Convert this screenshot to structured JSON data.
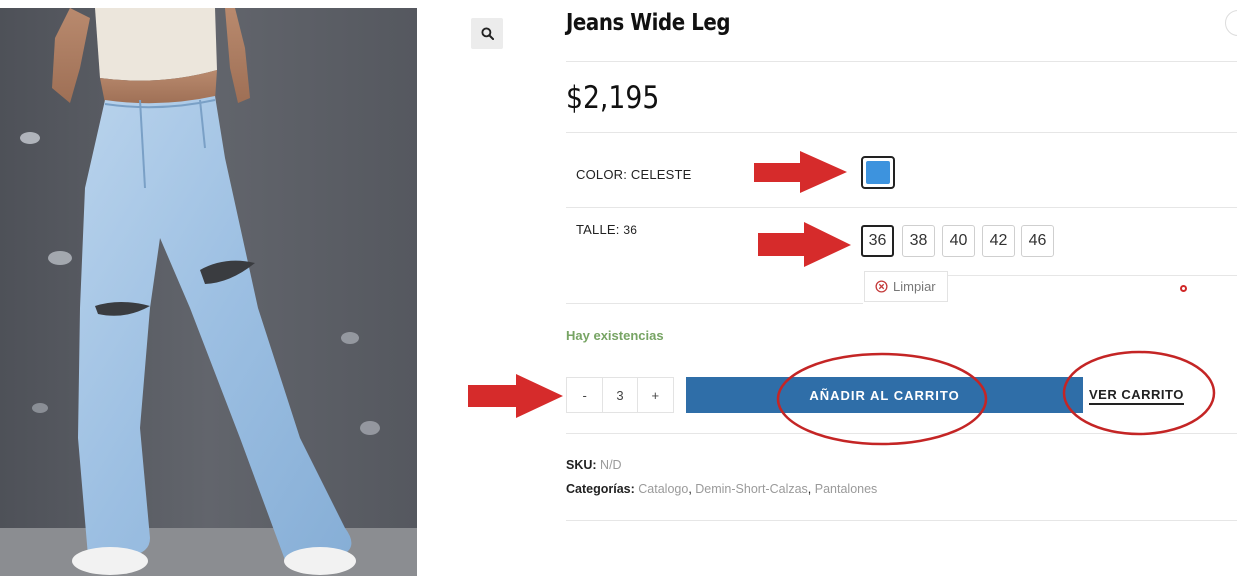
{
  "product": {
    "title": "Jeans Wide Leg",
    "price": "$2,195",
    "image_alt": "product-photo-jeans",
    "stock": "Hay existencias"
  },
  "attributes": {
    "color": {
      "label": "COLOR",
      "value": "CELESTE",
      "swatch_color": "#3d93de"
    },
    "size": {
      "label": "TALLE",
      "value": "36",
      "options": [
        "36",
        "38",
        "40",
        "42",
        "46"
      ],
      "selected": "36"
    },
    "clear_label": "Limpiar"
  },
  "cart": {
    "quantity": "3",
    "minus_label": "-",
    "plus_label": "+",
    "add_label": "AÑADIR AL CARRITO",
    "view_label": "VER CARRITO"
  },
  "meta": {
    "sku_label": "SKU:",
    "sku_value": "N/D",
    "categories_label": "Categorías:",
    "categories": [
      "Catalogo",
      "Demin-Short-Calzas",
      "Pantalones"
    ]
  },
  "colors": {
    "accent_button": "#2f6ea8",
    "stock_green": "#77a464",
    "annotation_red": "#d62b2b"
  },
  "icons": {
    "zoom": "search-icon",
    "clear": "close-circle-icon"
  }
}
